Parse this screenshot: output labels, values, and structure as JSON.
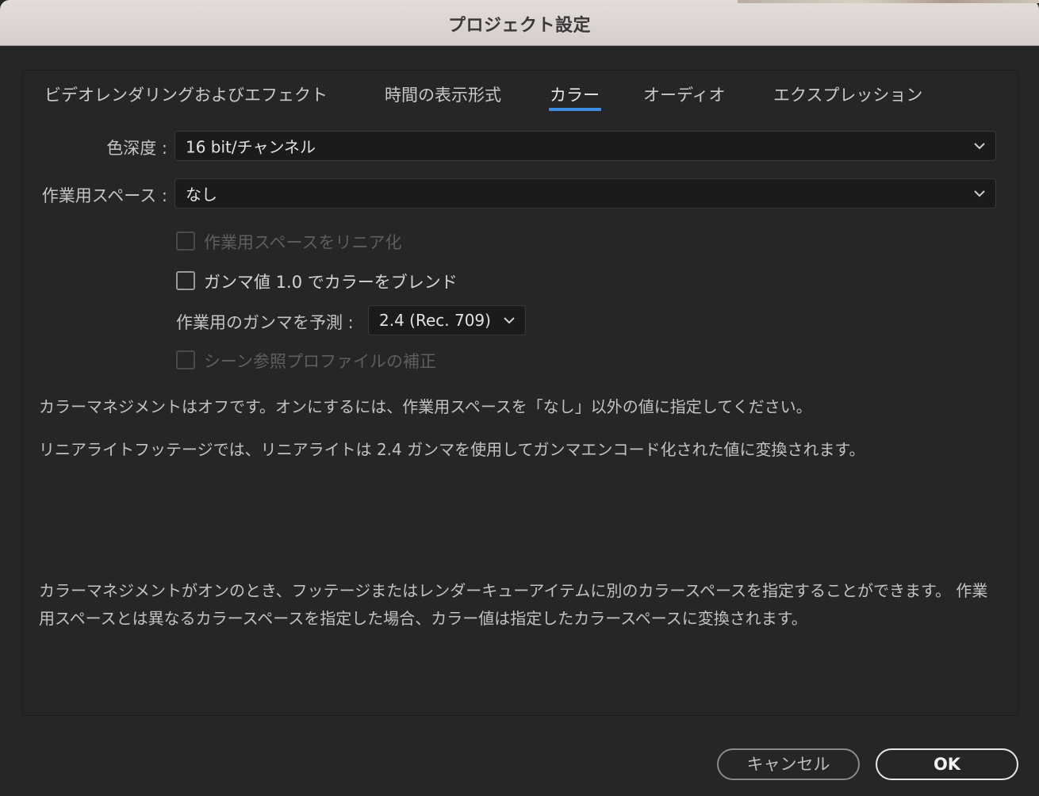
{
  "window": {
    "title": "プロジェクト設定"
  },
  "tabs": [
    {
      "label": "ビデオレンダリングおよびエフェクト",
      "active": false
    },
    {
      "label": "時間の表示形式",
      "active": false
    },
    {
      "label": "カラー",
      "active": true
    },
    {
      "label": "オーディオ",
      "active": false
    },
    {
      "label": "エクスプレッション",
      "active": false
    }
  ],
  "color_settings": {
    "bit_depth": {
      "label": "色深度 :",
      "value": "16 bit/チャンネル"
    },
    "working_space": {
      "label": "作業用スペース :",
      "value": "なし"
    },
    "linearize": {
      "label": "作業用スペースをリニア化",
      "checked": false,
      "disabled": true
    },
    "blend_gamma": {
      "label": "ガンマ値 1.0 でカラーをブレンド",
      "checked": false,
      "disabled": false
    },
    "working_gamma": {
      "label": "作業用のガンマを予測 :",
      "value": "2.4 (Rec. 709)"
    },
    "scene_profile": {
      "label": "シーン参照プロファイルの補正",
      "checked": false,
      "disabled": true
    }
  },
  "info": {
    "line1": "カラーマネジメントはオフです。オンにするには、作業用スペースを「なし」以外の値に指定してください。",
    "line2": "リニアライトフッテージでは、リニアライトは 2.4 ガンマを使用してガンマエンコード化された値に変換されます。",
    "line3": "カラーマネジメントがオンのとき、フッテージまたはレンダーキューアイテムに別のカラースペースを指定することができます。 作業用スペースとは異なるカラースペースを指定した場合、カラー値は指定したカラースペースに変換されます。"
  },
  "buttons": {
    "cancel": "キャンセル",
    "ok": "OK"
  },
  "colors": {
    "accent": "#3b8ee0",
    "background": "#262626",
    "titlebar": "#dcd4d1"
  }
}
